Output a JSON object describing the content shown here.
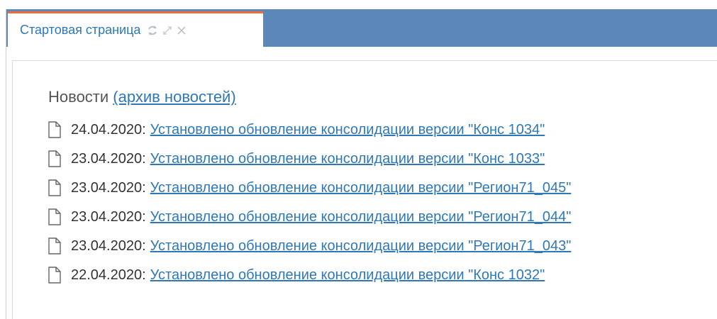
{
  "tab": {
    "title": "Стартовая страница"
  },
  "news": {
    "heading": "Новости",
    "archive_link": "(архив новостей)",
    "items": [
      {
        "date": "24.04.2020",
        "text": "Установлено обновление консолидации версии \"Конс 1034\""
      },
      {
        "date": "23.04.2020",
        "text": "Установлено обновление консолидации версии \"Конс 1033\""
      },
      {
        "date": "23.04.2020",
        "text": "Установлено обновление консолидации версии \"Регион71_045\""
      },
      {
        "date": "23.04.2020",
        "text": "Установлено обновление консолидации версии \"Регион71_044\""
      },
      {
        "date": "23.04.2020",
        "text": "Установлено обновление консолидации версии \"Регион71_043\""
      },
      {
        "date": "22.04.2020",
        "text": "Установлено обновление консолидации версии \"Конс 1032\""
      }
    ]
  },
  "colors": {
    "accent": "#ef6c43",
    "tabbar": "#5b88b8",
    "link": "#2f78b7"
  },
  "icons": {
    "refresh": "refresh-icon",
    "expand": "expand-icon",
    "close": "close-icon",
    "document": "document-icon"
  }
}
